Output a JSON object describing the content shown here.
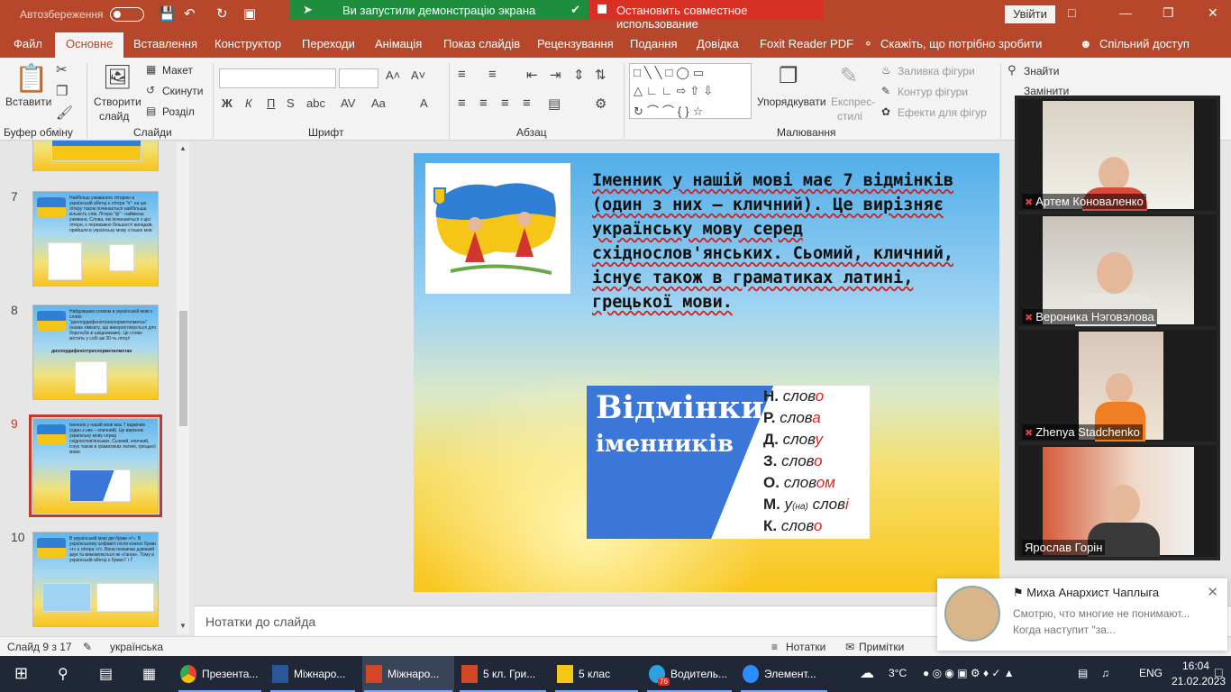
{
  "titlebar": {
    "autosave_label": "Автозбереження",
    "share_running": "Ви запустили демонстрацію экрана",
    "share_stop": "Остановить совместное использование",
    "signin": "Увійти"
  },
  "menu": {
    "items": [
      "Файл",
      "Основне",
      "Вставлення",
      "Конструктор",
      "Переходи",
      "Анімація",
      "Показ слайдів",
      "Рецензування",
      "Подання",
      "Довідка",
      "Foxit Reader PDF"
    ],
    "active": "Основне",
    "tell_me": "Скажіть, що потрібно зробити",
    "share": "Спільний доступ"
  },
  "ribbon": {
    "paste": "Вставити",
    "clipboard": "Буфер обміну",
    "new_slide": "Створити",
    "new_slide_2": "слайд",
    "layout": "Макет",
    "reset": "Скинути",
    "section": "Розділ",
    "slides": "Слайди",
    "font_group": "Шрифт",
    "bold": "Ж",
    "italic": "К",
    "underline": "П",
    "strike": "S",
    "paragraph": "Абзац",
    "arrange": "Упорядкувати",
    "quick_styles": "Експрес-",
    "quick_styles_2": "стилі",
    "shape_fill": "Заливка фігури",
    "shape_outline": "Контур фігури",
    "shape_effects": "Ефекти для фігур",
    "drawing": "Малювання",
    "find": "Знайти",
    "replace": "Замінити"
  },
  "thumbnails": [
    {
      "num": "7",
      "text": "Найбільш уживаного літерою в українській абетці є літера \"п\": на цю літеру також починається найбільша кількість слів. Літера \"ф\" - найменш уживана. Слова, які починаються з цієї літери, є переважно більшості випадків, прийшли в українську мову з інших мов"
    },
    {
      "num": "8",
      "text": "Найдовшим словом в українській мові є слово \"дихлордифенілтрихлорметилметан\" (назва хімікату, що використовується для боротьби зі шкідниками). Це слово містить у собі аж 30-ть літер!",
      "bold": "дихлордифенілтрихлорметилметан"
    },
    {
      "num": "9",
      "text": "Іменник у нашій мові має 7 відмінків (один з них – кличний). Це вирізняє українську мову серед східнослов'янських. Сьомий, кличний, існує також в граматиках латині, грецької мови.",
      "selected": true
    },
    {
      "num": "10",
      "text": "В українській мові дві букви «ґ». В українському алфавіті після кожної букви «г» є літера «ґ». Вона позначає дзвінкий звук та вимовляється як «ґанок». Тому в українській абетці є букви Г і Ґ"
    }
  ],
  "slide": {
    "text": "Іменник у нашій мові має 7 відмінків (один з них – кличний). Це вирізняє українську мову серед східнослов'янських. Сьомий, кличний, існує також в граматиках латині, грецької мови.",
    "case_title_1": "Відмінки",
    "case_title_2": "іменників",
    "cases": [
      {
        "letter": "Н.",
        "stem": "слов",
        "ending": "о"
      },
      {
        "letter": "Р.",
        "stem": "слов",
        "ending": "а"
      },
      {
        "letter": "Д.",
        "stem": "слов",
        "ending": "у"
      },
      {
        "letter": "З.",
        "stem": "слов",
        "ending": "о"
      },
      {
        "letter": "О.",
        "stem": "слов",
        "ending": "ом"
      },
      {
        "letter": "М.",
        "stem": "слов",
        "ending": "і",
        "prefix": "у",
        "prefix_small": "(на)"
      },
      {
        "letter": "К.",
        "stem": "слов",
        "ending": "о"
      }
    ]
  },
  "notes_placeholder": "Нотатки до слайда",
  "status": {
    "slide_counter": "Слайд 9 з 17",
    "language": "українська",
    "notes": "Нотатки",
    "comments": "Примітки"
  },
  "participants": [
    {
      "name": "Артем Коноваленко",
      "muted": true
    },
    {
      "name": "Вероника Нэговэлова",
      "muted": true
    },
    {
      "name": "Zhenya Stadchenko",
      "muted": true
    },
    {
      "name": "Ярослав Горін",
      "muted": false
    }
  ],
  "notification": {
    "sender": "Миха Анархист Чаплыга",
    "message": "Смотрю, что многие не понимают... Когда наступит \"за..."
  },
  "taskbar": {
    "apps": [
      "Презента...",
      "Міжнаро...",
      "Міжнаро...",
      "5 кл. Гри...",
      "5 клас",
      "Водитель...",
      "Элемент..."
    ],
    "badge": "76",
    "weather": "3°C",
    "lang": "ENG",
    "time": "16:04",
    "date": "21.02.2023"
  },
  "colors": {
    "accent": "#b7472a",
    "share_green": "#1e8e3e",
    "share_red": "#d93025",
    "selected_thumb": "#c0392b"
  }
}
